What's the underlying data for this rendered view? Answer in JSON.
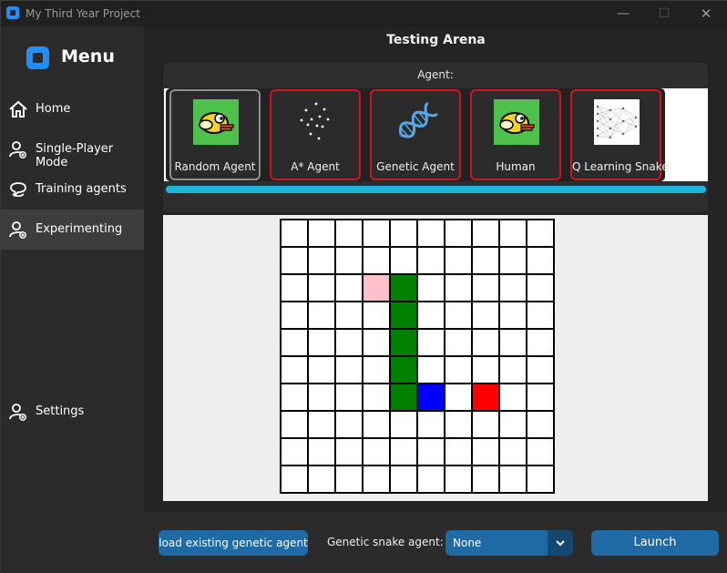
{
  "window": {
    "title": "My Third Year Project"
  },
  "sidebar": {
    "title": "Menu",
    "items": [
      {
        "label": "Home",
        "icon": "home-icon",
        "active": false
      },
      {
        "label": "Single-Player Mode",
        "icon": "user-add-icon",
        "active": false
      },
      {
        "label": "Training agents",
        "icon": "chat-icon",
        "active": false
      },
      {
        "label": "Experimenting",
        "icon": "user-add-icon",
        "active": true
      },
      {
        "label": "Settings",
        "icon": "user-add-icon",
        "active": false
      }
    ]
  },
  "main": {
    "title": "Testing Arena",
    "agent_label": "Agent:",
    "agents": [
      {
        "label": "Random Agent",
        "icon": "flappy-bird-icon",
        "selected": true
      },
      {
        "label": "A* Agent",
        "icon": "scatter-dots-icon",
        "selected": false
      },
      {
        "label": "Genetic  Agent",
        "icon": "dna-icon",
        "selected": false
      },
      {
        "label": "Human",
        "icon": "flappy-bird-icon",
        "selected": false
      },
      {
        "label": "Q Learning Snake",
        "icon": "neural-network-icon",
        "selected": false
      }
    ],
    "agent_scroll_progress": 1.0,
    "grid": {
      "rows": 10,
      "cols": 10,
      "snake": [
        [
          4,
          2
        ],
        [
          4,
          3
        ],
        [
          4,
          4
        ],
        [
          4,
          5
        ],
        [
          4,
          6
        ]
      ],
      "head": [
        5,
        6
      ],
      "food": [
        7,
        6
      ],
      "trail": [
        3,
        2
      ],
      "colors": {
        "snake": "#008000",
        "head": "#0000ff",
        "food": "#ff0000",
        "trail": "#ffc0cb",
        "cell": "#ffffff",
        "line": "#000000"
      }
    }
  },
  "bottom": {
    "load_button": "load existing genetic agent",
    "select_label": "Genetic snake agent:",
    "select_value": "None",
    "launch_button": "Launch"
  },
  "colors": {
    "accent": "#1f6aa5",
    "selected_border": "#8f8f8f",
    "card_border": "#d0141e",
    "progress": "#1fb6d9"
  }
}
